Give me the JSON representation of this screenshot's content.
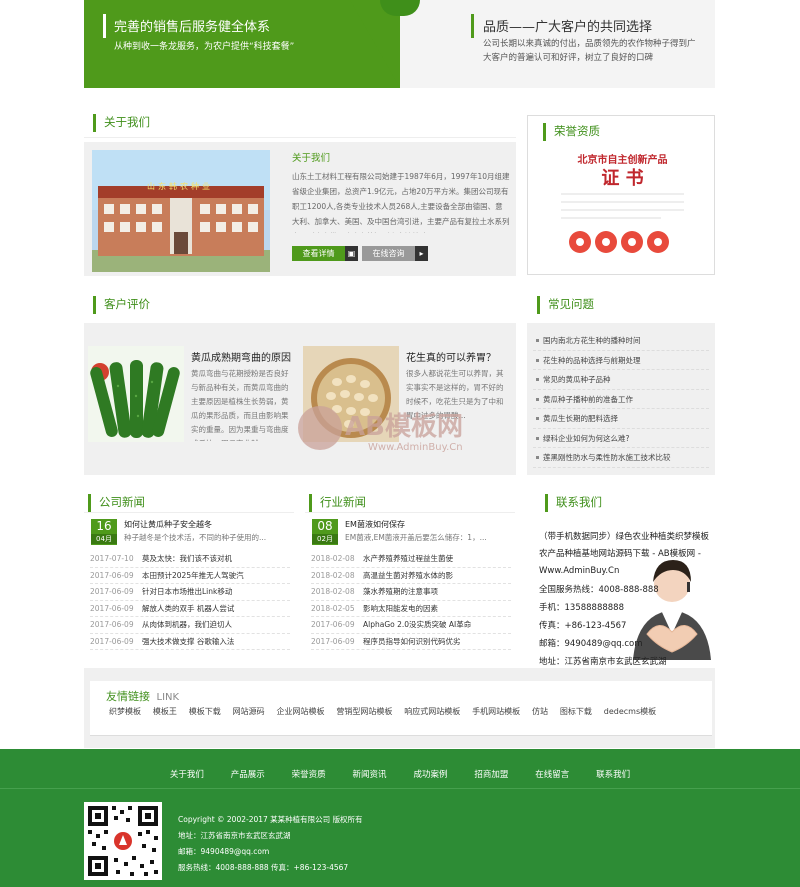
{
  "banner": {
    "left_title": "完善的销售后服务健全体系",
    "left_sub": "从种到收一条龙服务，为农户提供“科技套餐”",
    "right_title": "品质——广大客户的共同选择",
    "right_sub": "公司长期以来真诚的付出，品质领先的农作物种子得到广大客户的普遍认可和好评，树立了良好的口碑"
  },
  "about": {
    "heading": "关于我们",
    "title": "关于我们",
    "text": "山东土工材料工程有限公司始建于1987年6月，1997年10月组建省级企业集团，总资产1.9亿元，占地20万平方米。集团公司现有职工1200人,各类专业技术人员268人,主要设备全部由德国、意大利、加拿大、美国、及中国台湾引进，主要产品有复拉土水系列产品（止水带、止水条等）耐高寒填缝胶、PE、PVC、EVA、...",
    "btn_more": "查看详情",
    "btn_online": "在线咨询",
    "image_sign": "山东韩农种业"
  },
  "honor": {
    "heading": "荣誉资质",
    "cert_title": "北京市自主创新产品",
    "cert_big": "证  书"
  },
  "cases": {
    "heading": "客户评价",
    "items": [
      {
        "title": "黄瓜成熟期弯曲的原因",
        "text": "黄瓜弯曲与花期授粉是否良好与新品种有关，而黄瓜弯曲的主要原因是植株生长势弱，黄瓜的果形品质，而且由影响果实的重量。因为果重与弯曲度成反比，即瓜弯曲越..."
      },
      {
        "title": "花生真的可以养胃？",
        "text": "很多人都说花生可以养胃，其实事实不是这样的，胃不好的时候不，吃花生只是为了中和胃中过多的胃酸..."
      }
    ]
  },
  "faq": {
    "heading": "常见问题",
    "items": [
      "国内南北方花生种的播种时间",
      "花生种的品种选择与前期处理",
      "常见的黄瓜种子品种",
      "黄瓜种子播种前的准备工作",
      "黄瓜生长期的肥料选择",
      "绿科企业如何为何这么难?",
      "莲黑刚性防水与柔性防水施工技术比较"
    ]
  },
  "company_news": {
    "heading": "公司新闻",
    "featured": {
      "day": "16",
      "month": "04月",
      "title": "如何让黄瓜种子安全越冬",
      "desc": "种子越冬是个技术活，不同的种子使用的..."
    },
    "rows": [
      {
        "date": "2017-07-10",
        "title": "莫及太快：我们该不该对机"
      },
      {
        "date": "2017-06-09",
        "title": "本田预计2025年推无人驾驶汽"
      },
      {
        "date": "2017-06-09",
        "title": "针对日本市场推出Link移动"
      },
      {
        "date": "2017-06-09",
        "title": "解放人类的双手  机器人尝试"
      },
      {
        "date": "2017-06-09",
        "title": "从肉体到机器，我们迫切人"
      },
      {
        "date": "2017-06-09",
        "title": "强大技术做支撑  谷歌输入法"
      }
    ]
  },
  "industry_news": {
    "heading": "行业新闻",
    "featured": {
      "day": "08",
      "month": "02月",
      "title": "EM菌液如何保存",
      "desc": "EM菌液,EM菌液开盖后要怎么储存：1，..."
    },
    "rows": [
      {
        "date": "2018-02-08",
        "title": "水产养殖养殖过程益生菌使"
      },
      {
        "date": "2018-02-08",
        "title": "高温益生菌对养殖水体的影"
      },
      {
        "date": "2018-02-08",
        "title": "藻水养殖期的注意事项"
      },
      {
        "date": "2018-02-05",
        "title": "影响太阳能发电的因素"
      },
      {
        "date": "2017-06-09",
        "title": "AlphaGo 2.0没实质突破 AI革命"
      },
      {
        "date": "2017-06-09",
        "title": "程序员指导如何识别代码优劣"
      }
    ]
  },
  "contact": {
    "heading": "联系我们",
    "intro": "（带手机数据同步）绿色农业种植类织梦模板 农产品种植基地网站源码下载 - AB模板网 - Www.AdminBuy.Cn",
    "hotline": "全国服务热线：4008-888-888",
    "mobile": "手机：13588888888",
    "fax": "传真：+86-123-4567",
    "email": "邮箱：9490489@qq.com",
    "address": "地址：江苏省南京市玄武区玄武湖"
  },
  "links": {
    "heading": "友情链接",
    "heading_en": "LINK",
    "items": [
      "织梦模板",
      "模板王",
      "模板下载",
      "网站源码",
      "企业网站模板",
      "营销型网站模板",
      "响应式网站模板",
      "手机网站模板",
      "仿站",
      "图标下载",
      "dedecms模板"
    ]
  },
  "footer": {
    "nav": [
      "关于我们",
      "产品展示",
      "荣誉资质",
      "新闻资讯",
      "成功案例",
      "招商加盟",
      "在线留言",
      "联系我们"
    ],
    "copyright": "Copyright © 2002-2017 某某种植有限公司 版权所有",
    "address": "地址：江苏省南京市玄武区玄武湖",
    "email": "邮箱：9490489@qq.com",
    "phones": "服务热线：4008-888-888 传真：+86-123-4567"
  },
  "watermark": {
    "brand": "AB模板网",
    "url": "Www.AdminBuy.Cn"
  },
  "colors": {
    "accent": "#4f9a1b",
    "footer": "#2d8c35"
  }
}
